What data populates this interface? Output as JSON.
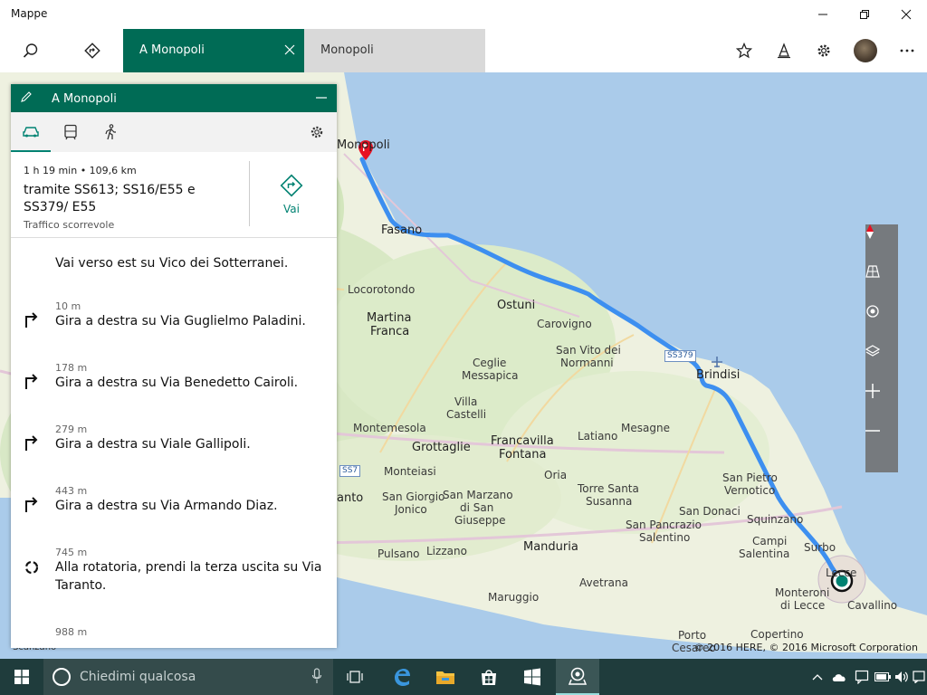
{
  "window": {
    "app_title": "Mappe",
    "minimize_icon": "minimize-icon",
    "maximize_icon": "restore-icon",
    "close_icon": "close-icon"
  },
  "header": {
    "search_icon": "search-icon",
    "directions_icon": "directions-icon",
    "tabs": [
      {
        "label": "A Monopoli",
        "active": true,
        "close_icon": "close-icon"
      },
      {
        "label": "Monopoli",
        "active": false
      }
    ],
    "right_icons": [
      "star-icon",
      "ink-icon",
      "gear-icon",
      "avatar",
      "more-icon"
    ]
  },
  "panel": {
    "title": "A Monopoli",
    "modes": [
      {
        "name": "car-icon",
        "active": true
      },
      {
        "name": "transit-icon",
        "active": false
      },
      {
        "name": "walk-icon",
        "active": false
      }
    ],
    "summary": {
      "stats": "1 h 19 min  •  109,6 km",
      "via": "tramite SS613; SS16/E55 e SS379/ E55",
      "traffic": "Traffico scorrevole",
      "go_label": "Vai"
    },
    "steps": [
      {
        "distance": "",
        "instruction": "Vai verso est su Vico dei Sotterranei.",
        "icon": "none"
      },
      {
        "distance": "10 m",
        "instruction": "Gira a destra su Via Guglielmo Paladini.",
        "icon": "turn-right-icon"
      },
      {
        "distance": "178 m",
        "instruction": "Gira a destra su Via Benedetto Cairoli.",
        "icon": "turn-right-icon"
      },
      {
        "distance": "279 m",
        "instruction": "Gira a destra su Viale Gallipoli.",
        "icon": "turn-right-icon"
      },
      {
        "distance": "443 m",
        "instruction": "Gira a destra su Via Armando Diaz.",
        "icon": "turn-right-icon"
      },
      {
        "distance": "745 m",
        "instruction": "Alla rotatoria, prendi la terza uscita su Via Taranto.",
        "icon": "roundabout-icon"
      },
      {
        "distance": "988 m",
        "instruction": "",
        "icon": "none"
      }
    ]
  },
  "map": {
    "labels": {
      "monopoli": "Monopoli",
      "fasano": "Fasano",
      "locorotondo": "Locorotondo",
      "ostuni": "Ostuni",
      "martina": "Martina",
      "franca": "Franca",
      "carovigno": "Carovigno",
      "sanvito1": "San Vito dei",
      "sanvito2": "Normanni",
      "ceglie1": "Ceglie",
      "ceglie2": "Messapica",
      "villa1": "Villa",
      "villa2": "Castelli",
      "brindisi": "Brindisi",
      "montemesola": "Montemesola",
      "grottaglie": "Grottaglie",
      "francavilla1": "Francavilla",
      "francavilla2": "Fontana",
      "latiano": "Latiano",
      "mesagne": "Mesagne",
      "monteiasi": "Monteiasi",
      "oria": "Oria",
      "taranto": "anto",
      "sangiorgio1": "San Giorgio",
      "sangiorgio2": "Jonico",
      "sanmarzano1": "San Marzano",
      "sanmarzano2": "di San",
      "sanmarzano3": "Giuseppe",
      "torresanta1": "Torre Santa",
      "torresanta2": "Susanna",
      "sandonaci": "San Donaci",
      "sanpietro1": "San Pietro",
      "sanpietro2": "Vernotico",
      "squinzano": "Squinzano",
      "sanpancrazio1": "San Pancrazio",
      "sanpancrazio2": "Salentino",
      "campi1": "Campi",
      "campi2": "Salentina",
      "surbo": "Surbo",
      "lecce": "Lecce",
      "manduria": "Manduria",
      "pulsano": "Pulsano",
      "lizzano": "Lizzano",
      "maruggio": "Maruggio",
      "avetrana": "Avetrana",
      "monteroni1": "Monteroni",
      "monteroni2": "di Lecce",
      "cavallino": "Cavallino",
      "copertino": "Copertino",
      "porto": "Porto",
      "cesareo": "Cesareo",
      "scanzano": "Scanzano",
      "ss379": "SS379",
      "ss7": "SS7"
    },
    "copyright": "© 2016 HERE, © 2016 Microsoft Corporation",
    "controls": [
      "compass-icon",
      "3d-view-icon",
      "locate-icon",
      "layers-icon",
      "zoom-in-icon",
      "zoom-out-icon"
    ]
  },
  "taskbar": {
    "search_placeholder": "Chiedimi qualcosa",
    "apps": [
      "task-view-icon",
      "edge-icon",
      "file-explorer-icon",
      "store-icon",
      "windows-app-icon",
      "maps-app-icon"
    ],
    "tray": [
      "chevron-up-icon",
      "cloud-icon",
      "notes-icon",
      "battery-icon",
      "volume-icon",
      "notifications-icon"
    ]
  },
  "colors": {
    "accent": "#006b55",
    "route": "#3d8ff0",
    "taskbar": "#1f3c3c"
  }
}
